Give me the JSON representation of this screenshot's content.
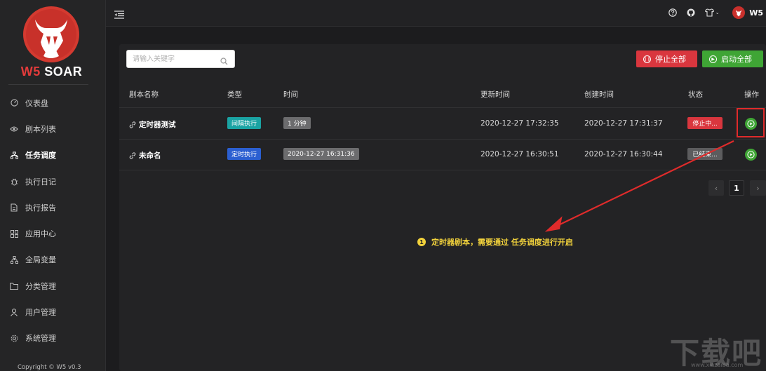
{
  "brand": {
    "prefix": "W5",
    "suffix": " SOAR"
  },
  "sidebar": {
    "items": [
      {
        "label": "仪表盘",
        "icon": "dashboard-icon"
      },
      {
        "label": "剧本列表",
        "icon": "eye-icon"
      },
      {
        "label": "任务调度",
        "icon": "schedule-icon",
        "active": true
      },
      {
        "label": "执行日记",
        "icon": "bug-icon"
      },
      {
        "label": "执行报告",
        "icon": "report-icon"
      },
      {
        "label": "应用中心",
        "icon": "apps-icon"
      },
      {
        "label": "全局变量",
        "icon": "tree-icon"
      },
      {
        "label": "分类管理",
        "icon": "folder-icon"
      },
      {
        "label": "用户管理",
        "icon": "user-icon"
      },
      {
        "label": "系统管理",
        "icon": "gear-icon"
      }
    ],
    "copyright": "Copyright © W5 v0.3"
  },
  "header": {
    "user": "W5"
  },
  "toolbar": {
    "search_placeholder": "请输入关键字",
    "stop_all": "停止全部",
    "start_all": "启动全部"
  },
  "table": {
    "columns": [
      "剧本名称",
      "类型",
      "时间",
      "更新时间",
      "创建时间",
      "状态",
      "操作"
    ],
    "rows": [
      {
        "name": "定时器测试",
        "type": "间隔执行",
        "time": "1 分钟",
        "updated": "2020-12-27 17:32:35",
        "created": "2020-12-27 17:31:37",
        "status": "停止中..."
      },
      {
        "name": "未命名",
        "type": "定时执行",
        "time": "2020-12-27 16:31:36",
        "updated": "2020-12-27 16:30:51",
        "created": "2020-12-27 16:30:44",
        "status": "已结束..."
      }
    ]
  },
  "pagination": {
    "prev": "‹",
    "page": "1",
    "next": "›"
  },
  "annotation": {
    "number": "1",
    "text": "定时器剧本，需要通过 任务调度进行开启"
  },
  "watermark": {
    "text": "下载吧",
    "sub": "www.xiazaiba.com"
  },
  "colors": {
    "stop": "#d9363e",
    "start": "#3fa535",
    "interval": "#1aa3a3",
    "timed": "#2b5fd1",
    "annotation": "#f2d23c"
  }
}
